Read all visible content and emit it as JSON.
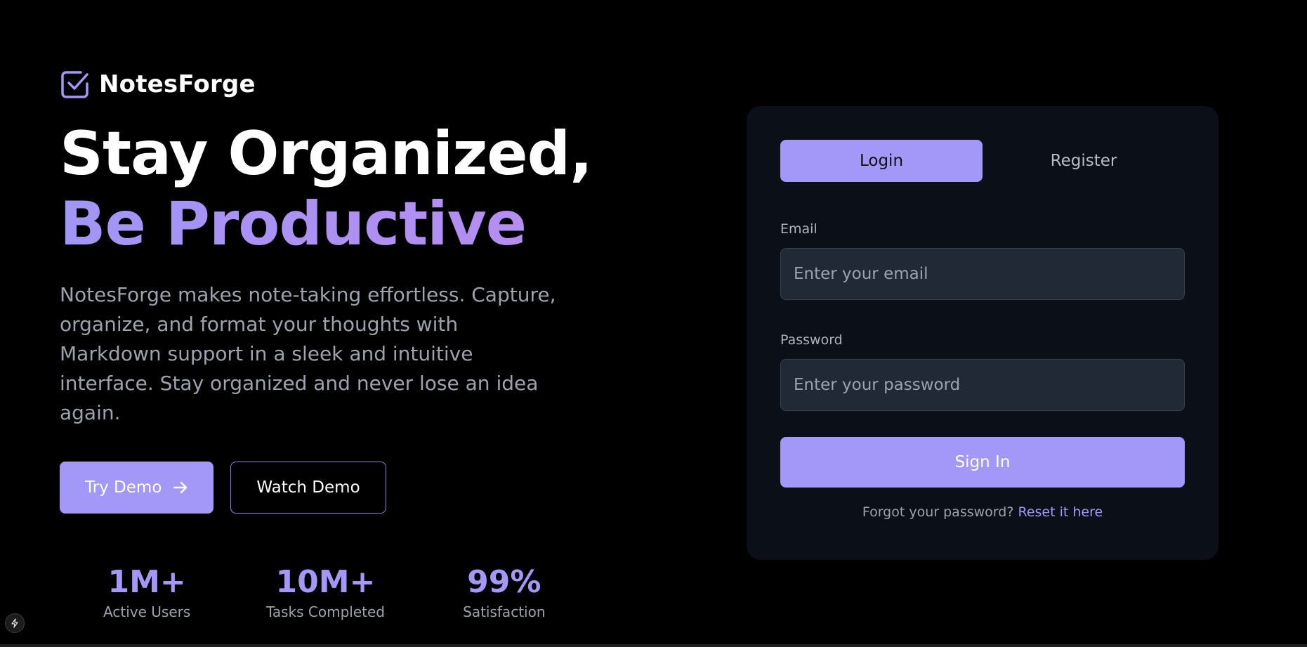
{
  "brand": {
    "name": "NotesForge",
    "icon": "checkbox-icon",
    "accent_color": "#a397f8"
  },
  "hero": {
    "headline_line1": "Stay Organized,",
    "headline_line2": "Be Productive",
    "description": "NotesForge makes note-taking effortless. Capture, organize, and format your thoughts with Markdown support in a sleek and intuitive interface. Stay organized and never lose an idea again.",
    "primary_cta": {
      "label": "Try Demo",
      "icon": "arrow-right-icon"
    },
    "secondary_cta": {
      "label": "Watch Demo"
    },
    "stats": [
      {
        "value": "1M+",
        "label": "Active Users"
      },
      {
        "value": "10M+",
        "label": "Tasks Completed"
      },
      {
        "value": "99%",
        "label": "Satisfaction"
      }
    ]
  },
  "auth": {
    "tabs": [
      {
        "label": "Login",
        "active": true
      },
      {
        "label": "Register",
        "active": false
      }
    ],
    "email": {
      "label": "Email",
      "placeholder": "Enter your email",
      "value": ""
    },
    "password": {
      "label": "Password",
      "placeholder": "Enter your password",
      "value": ""
    },
    "submit_label": "Sign In",
    "forgot_text": "Forgot your password?",
    "reset_link": "Reset it here"
  },
  "corner_badge": {
    "icon": "lightning-bolt-icon"
  },
  "colors": {
    "background": "#000000",
    "card": "#0b0f17",
    "input": "#212936",
    "muted_text": "#9ca3af"
  }
}
